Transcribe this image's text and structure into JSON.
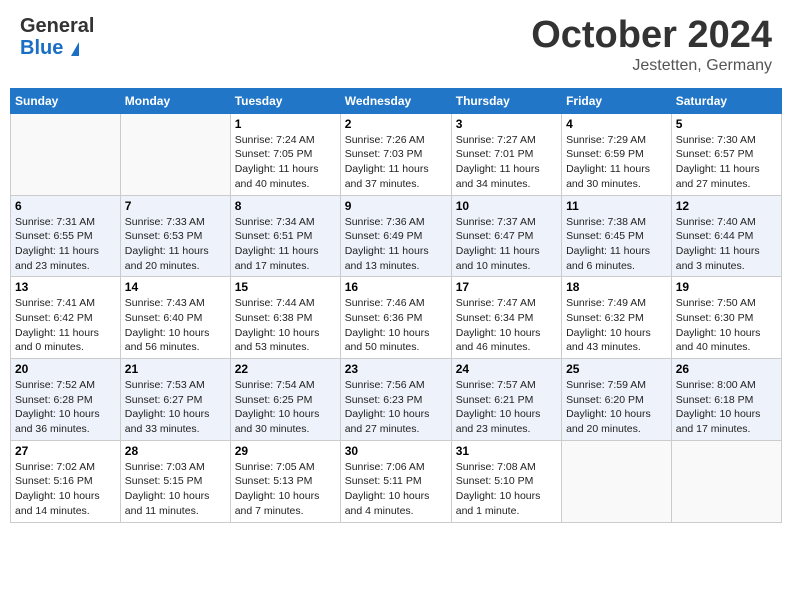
{
  "header": {
    "logo_general": "General",
    "logo_blue": "Blue",
    "month": "October 2024",
    "location": "Jestetten, Germany"
  },
  "days_of_week": [
    "Sunday",
    "Monday",
    "Tuesday",
    "Wednesday",
    "Thursday",
    "Friday",
    "Saturday"
  ],
  "weeks": [
    [
      {
        "day": "",
        "info": ""
      },
      {
        "day": "",
        "info": ""
      },
      {
        "day": "1",
        "info": "Sunrise: 7:24 AM\nSunset: 7:05 PM\nDaylight: 11 hours and 40 minutes."
      },
      {
        "day": "2",
        "info": "Sunrise: 7:26 AM\nSunset: 7:03 PM\nDaylight: 11 hours and 37 minutes."
      },
      {
        "day": "3",
        "info": "Sunrise: 7:27 AM\nSunset: 7:01 PM\nDaylight: 11 hours and 34 minutes."
      },
      {
        "day": "4",
        "info": "Sunrise: 7:29 AM\nSunset: 6:59 PM\nDaylight: 11 hours and 30 minutes."
      },
      {
        "day": "5",
        "info": "Sunrise: 7:30 AM\nSunset: 6:57 PM\nDaylight: 11 hours and 27 minutes."
      }
    ],
    [
      {
        "day": "6",
        "info": "Sunrise: 7:31 AM\nSunset: 6:55 PM\nDaylight: 11 hours and 23 minutes."
      },
      {
        "day": "7",
        "info": "Sunrise: 7:33 AM\nSunset: 6:53 PM\nDaylight: 11 hours and 20 minutes."
      },
      {
        "day": "8",
        "info": "Sunrise: 7:34 AM\nSunset: 6:51 PM\nDaylight: 11 hours and 17 minutes."
      },
      {
        "day": "9",
        "info": "Sunrise: 7:36 AM\nSunset: 6:49 PM\nDaylight: 11 hours and 13 minutes."
      },
      {
        "day": "10",
        "info": "Sunrise: 7:37 AM\nSunset: 6:47 PM\nDaylight: 11 hours and 10 minutes."
      },
      {
        "day": "11",
        "info": "Sunrise: 7:38 AM\nSunset: 6:45 PM\nDaylight: 11 hours and 6 minutes."
      },
      {
        "day": "12",
        "info": "Sunrise: 7:40 AM\nSunset: 6:44 PM\nDaylight: 11 hours and 3 minutes."
      }
    ],
    [
      {
        "day": "13",
        "info": "Sunrise: 7:41 AM\nSunset: 6:42 PM\nDaylight: 11 hours and 0 minutes."
      },
      {
        "day": "14",
        "info": "Sunrise: 7:43 AM\nSunset: 6:40 PM\nDaylight: 10 hours and 56 minutes."
      },
      {
        "day": "15",
        "info": "Sunrise: 7:44 AM\nSunset: 6:38 PM\nDaylight: 10 hours and 53 minutes."
      },
      {
        "day": "16",
        "info": "Sunrise: 7:46 AM\nSunset: 6:36 PM\nDaylight: 10 hours and 50 minutes."
      },
      {
        "day": "17",
        "info": "Sunrise: 7:47 AM\nSunset: 6:34 PM\nDaylight: 10 hours and 46 minutes."
      },
      {
        "day": "18",
        "info": "Sunrise: 7:49 AM\nSunset: 6:32 PM\nDaylight: 10 hours and 43 minutes."
      },
      {
        "day": "19",
        "info": "Sunrise: 7:50 AM\nSunset: 6:30 PM\nDaylight: 10 hours and 40 minutes."
      }
    ],
    [
      {
        "day": "20",
        "info": "Sunrise: 7:52 AM\nSunset: 6:28 PM\nDaylight: 10 hours and 36 minutes."
      },
      {
        "day": "21",
        "info": "Sunrise: 7:53 AM\nSunset: 6:27 PM\nDaylight: 10 hours and 33 minutes."
      },
      {
        "day": "22",
        "info": "Sunrise: 7:54 AM\nSunset: 6:25 PM\nDaylight: 10 hours and 30 minutes."
      },
      {
        "day": "23",
        "info": "Sunrise: 7:56 AM\nSunset: 6:23 PM\nDaylight: 10 hours and 27 minutes."
      },
      {
        "day": "24",
        "info": "Sunrise: 7:57 AM\nSunset: 6:21 PM\nDaylight: 10 hours and 23 minutes."
      },
      {
        "day": "25",
        "info": "Sunrise: 7:59 AM\nSunset: 6:20 PM\nDaylight: 10 hours and 20 minutes."
      },
      {
        "day": "26",
        "info": "Sunrise: 8:00 AM\nSunset: 6:18 PM\nDaylight: 10 hours and 17 minutes."
      }
    ],
    [
      {
        "day": "27",
        "info": "Sunrise: 7:02 AM\nSunset: 5:16 PM\nDaylight: 10 hours and 14 minutes."
      },
      {
        "day": "28",
        "info": "Sunrise: 7:03 AM\nSunset: 5:15 PM\nDaylight: 10 hours and 11 minutes."
      },
      {
        "day": "29",
        "info": "Sunrise: 7:05 AM\nSunset: 5:13 PM\nDaylight: 10 hours and 7 minutes."
      },
      {
        "day": "30",
        "info": "Sunrise: 7:06 AM\nSunset: 5:11 PM\nDaylight: 10 hours and 4 minutes."
      },
      {
        "day": "31",
        "info": "Sunrise: 7:08 AM\nSunset: 5:10 PM\nDaylight: 10 hours and 1 minute."
      },
      {
        "day": "",
        "info": ""
      },
      {
        "day": "",
        "info": ""
      }
    ]
  ]
}
